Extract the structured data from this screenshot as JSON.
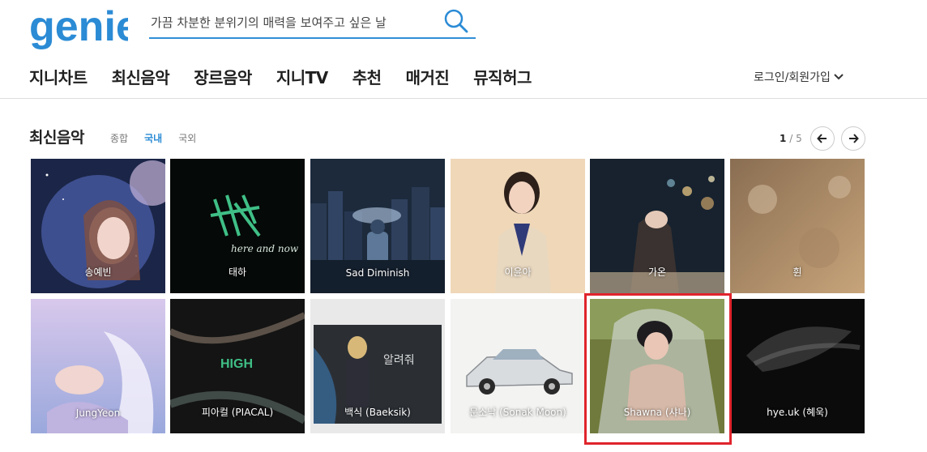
{
  "logo": {
    "text": "genie",
    "color": "#2b8bd5"
  },
  "search": {
    "value": "가끔 차분한 분위기의 매력을 보여주고 싶은 날",
    "icon": "search-icon"
  },
  "nav": {
    "items": [
      "지니차트",
      "최신음악",
      "장르음악",
      "지니TV",
      "추천",
      "매거진",
      "뮤직허그"
    ],
    "login": "로그인/회원가입"
  },
  "section": {
    "title": "최신음악",
    "subtabs": [
      "종합",
      "국내",
      "국외"
    ],
    "active_subtab": "국내",
    "pager": {
      "current": "1",
      "separator": "/",
      "total": "5"
    }
  },
  "albums": [
    {
      "artist": "송예빈"
    },
    {
      "artist": "태하"
    },
    {
      "artist": "Sad Diminish"
    },
    {
      "artist": "이윤아"
    },
    {
      "artist": "가온"
    },
    {
      "artist": "휜"
    },
    {
      "artist": "JungYeon"
    },
    {
      "artist": "피아컬 (PIACAL)"
    },
    {
      "artist": "백식 (Baeksik)"
    },
    {
      "artist": "문소낙 (Sonak Moon)"
    },
    {
      "artist": "Shawna (샤나)"
    },
    {
      "artist": "hye.uk (혜욱)"
    }
  ],
  "album_text": {
    "taeha": "here and now",
    "piacal": "HIGH",
    "baeksik": "알려줘"
  },
  "colors": {
    "accent": "#2b8bd5",
    "highlight": "#e0242c"
  }
}
